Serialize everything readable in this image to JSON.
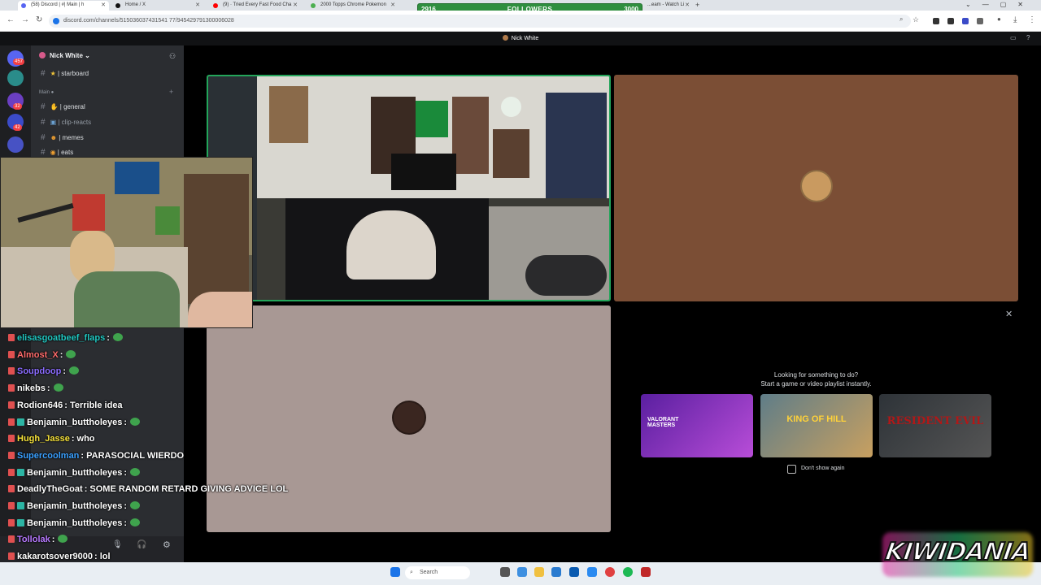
{
  "browser": {
    "tabs": [
      {
        "label": "(58) Discord | #| Main | h",
        "color": "#5865f2",
        "active": true
      },
      {
        "label": "Home / X",
        "color": "#111111"
      },
      {
        "label": "(9) · Tried Every Fast Food Cha",
        "color": "#ff0000"
      },
      {
        "label": "2000 Topps Chrome Pokemon",
        "color": "#4caf50"
      },
      {
        "label": "...eam - Watch Li",
        "color": "#9146ff"
      }
    ],
    "url": "discord.com/channels/515036037431541 77/945429791300006028"
  },
  "followers_goal": {
    "min": "2916",
    "label": "FOLLOWERS",
    "max": "3000",
    "progress": 0
  },
  "call": {
    "title": "Nick White"
  },
  "server": {
    "name": "Nick White",
    "badges": [
      "457",
      "32",
      "42"
    ],
    "channels": [
      {
        "name": "| starboard"
      },
      {
        "name": "| general"
      },
      {
        "name": "| clip-reacts"
      },
      {
        "name": "| memes"
      },
      {
        "name": "| eats"
      }
    ],
    "category": "Main"
  },
  "activity": {
    "prompt_line1": "Looking for something to do?",
    "prompt_line2": "Start a game or video playlist instantly.",
    "cards": [
      {
        "title": "VALORANT MASTERS",
        "bg": "#7a2fb8"
      },
      {
        "title": "KING OF HILL",
        "bg": "#4d6a76"
      },
      {
        "title": "RESIDENT EVIL",
        "bg": "#3a3f45"
      }
    ],
    "dont_show": "Don't show again"
  },
  "chat": [
    {
      "user": "elisasgoatbeef_flaps",
      "text": ":",
      "color": "#21c8c2"
    },
    {
      "user": "Almost_X",
      "text": ":",
      "color": "#ff6b6b"
    },
    {
      "user": "Soupdoop",
      "text": ":",
      "color": "#8b6cff"
    },
    {
      "user": "nikebs",
      "text": ":",
      "color": "#ffffff"
    },
    {
      "user": "Rodion646",
      "text": ": Terrible idea",
      "color": "#ffffff"
    },
    {
      "user": "Benjamin_buttholeyes",
      "text": ":",
      "color": "#ffffff"
    },
    {
      "user": "Hugh_Jasse",
      "text": ": who",
      "color": "#f5e13a"
    },
    {
      "user": "Supercoolman",
      "text": ": PARASOCIAL WIERDO",
      "color": "#3aa0ff"
    },
    {
      "user": "Benjamin_buttholeyes",
      "text": ":",
      "color": "#ffffff"
    },
    {
      "user": "DeadlyTheGoat",
      "text": ": SOME RANDOM RETARD GIVING ADVICE LOL",
      "color": "#ffffff"
    },
    {
      "user": "Benjamin_buttholeyes",
      "text": ":",
      "color": "#ffffff"
    },
    {
      "user": "Benjamin_buttholeyes",
      "text": ":",
      "color": "#ffffff"
    },
    {
      "user": "Tollolak",
      "text": ":",
      "color": "#b779ff"
    },
    {
      "user": "kakarotsover9000",
      "text": ": lol",
      "color": "#ffffff"
    }
  ],
  "taskbar": {
    "search": "Search"
  },
  "logo": {
    "text": "KIWIDANIA"
  }
}
